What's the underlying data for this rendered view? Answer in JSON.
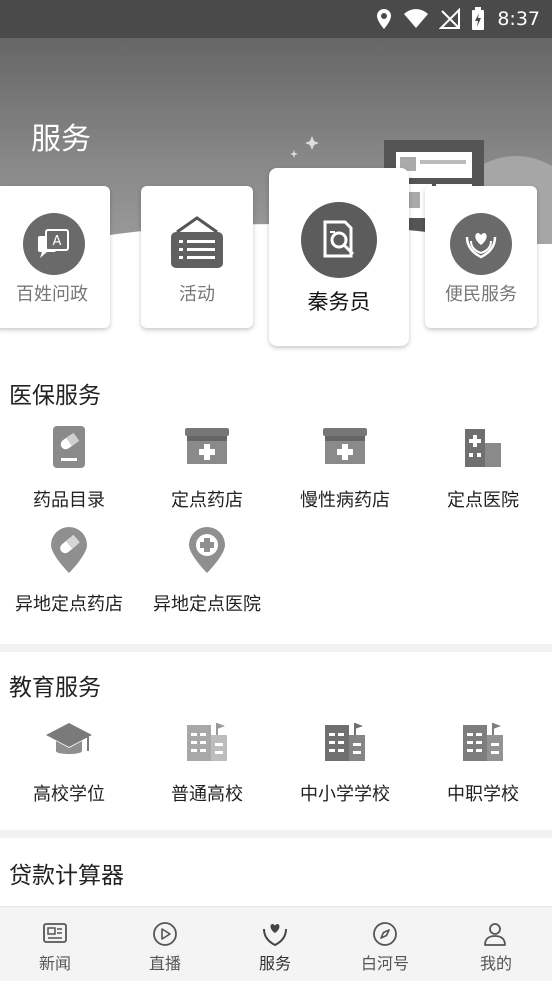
{
  "status_bar": {
    "time": "8:37"
  },
  "header": {
    "title": "服务"
  },
  "top_cards": [
    {
      "label": "百姓问政"
    },
    {
      "label": "活动"
    },
    {
      "label": "秦务员"
    },
    {
      "label": "便民服务"
    }
  ],
  "sections": {
    "medical": {
      "title": "医保服务",
      "items": [
        {
          "label": "药品目录",
          "icon": "pill-box-icon"
        },
        {
          "label": "定点药店",
          "icon": "pharmacy-icon"
        },
        {
          "label": "慢性病药店",
          "icon": "pharmacy-icon"
        },
        {
          "label": "定点医院",
          "icon": "hospital-icon"
        },
        {
          "label": "异地定点药店",
          "icon": "pin-pill-icon"
        },
        {
          "label": "异地定点医院",
          "icon": "pin-cross-icon"
        }
      ]
    },
    "education": {
      "title": "教育服务",
      "items": [
        {
          "label": "高校学位",
          "icon": "graduation-cap-icon"
        },
        {
          "label": "普通高校",
          "icon": "school-building-icon"
        },
        {
          "label": "中小学学校",
          "icon": "school-building-icon"
        },
        {
          "label": "中职学校",
          "icon": "school-building-icon"
        }
      ]
    },
    "loan": {
      "title": "贷款计算器"
    }
  },
  "tabbar": [
    {
      "label": "新闻",
      "icon": "news-icon"
    },
    {
      "label": "直播",
      "icon": "play-icon"
    },
    {
      "label": "服务",
      "icon": "service-heart-icon"
    },
    {
      "label": "白河号",
      "icon": "compass-icon"
    },
    {
      "label": "我的",
      "icon": "user-icon"
    }
  ]
}
